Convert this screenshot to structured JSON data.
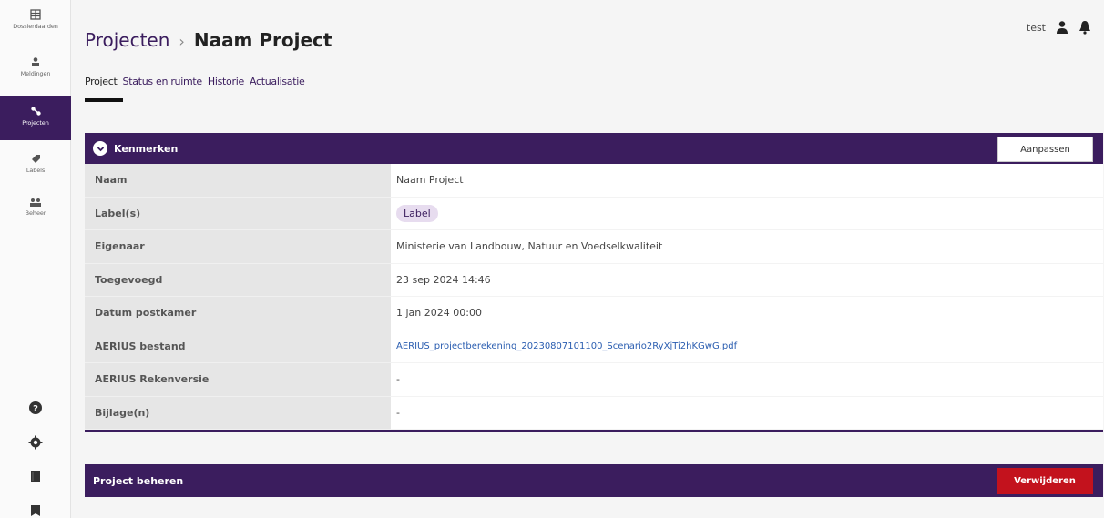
{
  "sidebar": {
    "items": [
      {
        "label": "Dossierdaarden",
        "icon": "dossier-icon"
      },
      {
        "label": "Meldingen",
        "icon": "user-icon"
      },
      {
        "label": "Projecten",
        "icon": "projects-icon",
        "active": true
      },
      {
        "label": "Labels",
        "icon": "tag-icon"
      },
      {
        "label": "Beheer",
        "icon": "users-icon"
      }
    ],
    "bottom_icons": [
      "help-icon",
      "settings-icon",
      "book-icon",
      "info-icon"
    ]
  },
  "header": {
    "breadcrumb_root": "Projecten",
    "breadcrumb_sep": "›",
    "breadcrumb_current": "Naam Project",
    "user": "test"
  },
  "tabs": [
    "Project",
    "Status en ruimte",
    "Historie",
    "Actualisatie"
  ],
  "kenmerken": {
    "title": "Kenmerken",
    "edit_label": "Aanpassen",
    "rows": [
      {
        "key": "Naam",
        "value": "Naam Project"
      },
      {
        "key": "Label(s)",
        "value": "Label"
      },
      {
        "key": "Eigenaar",
        "value": "Ministerie van Landbouw, Natuur en Voedselkwaliteit"
      },
      {
        "key": "Toegevoegd",
        "value": "23 sep 2024 14:46"
      },
      {
        "key": "Datum postkamer",
        "value": "1 jan 2024 00:00"
      },
      {
        "key": "AERIUS bestand",
        "value": "AERIUS_projectberekening_20230807101100_Scenario2RyXjTi2hKGwG.pdf"
      },
      {
        "key": "AERIUS Rekenversie",
        "value": "-"
      },
      {
        "key": "Bijlage(n)",
        "value": "-"
      }
    ]
  },
  "beheer": {
    "title": "Project beheren",
    "delete_label": "Verwijderen"
  },
  "colors": {
    "primary": "#3b1d5e",
    "danger": "#c3121d",
    "label_bg": "#e7dcef"
  }
}
